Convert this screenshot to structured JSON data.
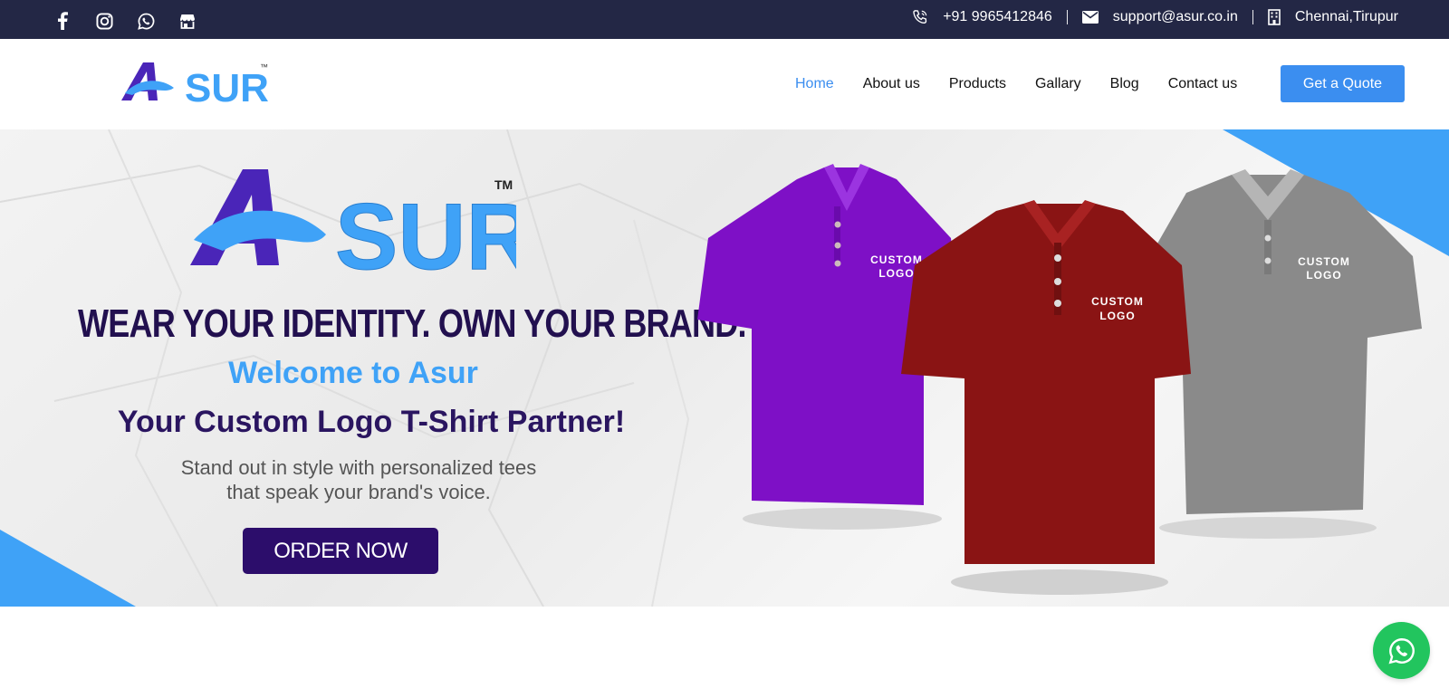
{
  "topbar": {
    "social_icons": [
      "facebook-icon",
      "instagram-icon",
      "whatsapp-icon",
      "store-icon"
    ],
    "phone": "+91 9965412846",
    "email": "support@asur.co.in",
    "location": "Chennai,Tirupur"
  },
  "nav": {
    "logo_text": "SUR",
    "logo_tm": "™",
    "items": [
      {
        "label": "Home",
        "active": true
      },
      {
        "label": "About us",
        "active": false
      },
      {
        "label": "Products",
        "active": false
      },
      {
        "label": "Gallary",
        "active": false
      },
      {
        "label": "Blog",
        "active": false
      },
      {
        "label": "Contact us",
        "active": false
      }
    ],
    "cta_label": "Get a Quote"
  },
  "hero": {
    "logo_text": "SUR",
    "logo_tm": "TM",
    "tagline": "WEAR YOUR IDENTITY. OWN YOUR BRAND.",
    "welcome": "Welcome to Asur",
    "headline": "Your Custom Logo T-Shirt Partner!",
    "description_line1": "Stand out in style with personalized tees",
    "description_line2": "that speak your brand's voice.",
    "cta_label": "ORDER NOW",
    "shirts": [
      {
        "color_name": "purple",
        "label_line1": "CUSTOM",
        "label_line2": "LOGO"
      },
      {
        "color_name": "maroon",
        "label_line1": "CUSTOM",
        "label_line2": "LOGO"
      },
      {
        "color_name": "grey",
        "label_line1": "CUSTOM",
        "label_line2": "LOGO"
      }
    ]
  },
  "colors": {
    "topbar_bg": "#232745",
    "accent_blue": "#3b8ef0",
    "brand_purple": "#2c0d6b",
    "light_blue": "#3fa2f7",
    "whatsapp_green": "#22c55e"
  },
  "floating": {
    "whatsapp_icon": "whatsapp-icon"
  }
}
